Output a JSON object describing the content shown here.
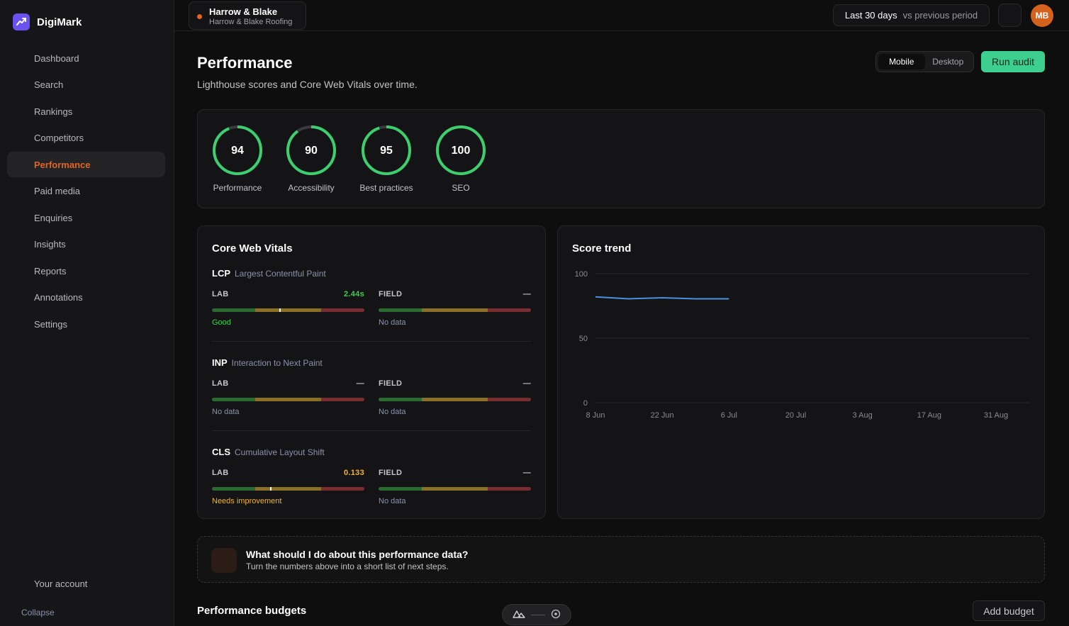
{
  "brand": {
    "name": "DigiMark",
    "logo_icon": "trend-icon"
  },
  "sidebar": {
    "items": [
      {
        "label": "Dashboard",
        "active": false
      },
      {
        "label": "Search",
        "active": false
      },
      {
        "label": "Rankings",
        "active": false
      },
      {
        "label": "Competitors",
        "active": false
      },
      {
        "label": "Performance",
        "active": true
      },
      {
        "label": "Paid media",
        "active": false
      },
      {
        "label": "Enquiries",
        "active": false
      },
      {
        "label": "Insights",
        "active": false
      },
      {
        "label": "Reports",
        "active": false
      },
      {
        "label": "Annotations",
        "active": false
      },
      {
        "label": "Settings",
        "active": false
      }
    ],
    "account_label": "Your account",
    "collapse_label": "Collapse"
  },
  "topbar": {
    "client_name": "Harrow & Blake",
    "client_sub": "Harrow & Blake Roofing",
    "range_main": "Last 30 days",
    "range_sub": "vs previous period",
    "avatar_initials": "MB"
  },
  "page": {
    "title": "Performance",
    "subtitle": "Lighthouse scores and Core Web Vitals over time.",
    "device_options": [
      "Mobile",
      "Desktop"
    ],
    "device_selected": "Mobile",
    "run_audit_label": "Run audit"
  },
  "scores": [
    {
      "value": "94",
      "label": "Performance",
      "fraction": 0.94
    },
    {
      "value": "90",
      "label": "Accessibility",
      "fraction": 0.9
    },
    {
      "value": "95",
      "label": "Best practices",
      "fraction": 0.95
    },
    {
      "value": "100",
      "label": "SEO",
      "fraction": 1.0
    }
  ],
  "cwv": {
    "title": "Core Web Vitals",
    "metrics": [
      {
        "abbr": "LCP",
        "full": "Largest Contentful Paint",
        "lab": {
          "label": "LAB",
          "value": "2.44s",
          "note": "Good",
          "status": "good",
          "marker_fraction": 0.44
        },
        "field": {
          "label": "FIELD",
          "value": "—",
          "note": "No data"
        }
      },
      {
        "abbr": "INP",
        "full": "Interaction to Next Paint",
        "lab": {
          "label": "LAB",
          "value": "—",
          "note": "No data",
          "status": "none",
          "marker_fraction": null
        },
        "field": {
          "label": "FIELD",
          "value": "—",
          "note": "No data"
        }
      },
      {
        "abbr": "CLS",
        "full": "Cumulative Layout Shift",
        "lab": {
          "label": "LAB",
          "value": "0.133",
          "note": "Needs improvement",
          "status": "warn",
          "marker_fraction": 0.38
        },
        "field": {
          "label": "FIELD",
          "value": "—",
          "note": "No data"
        }
      }
    ],
    "colors": {
      "good": "#3ccf4e",
      "warn": "#f0b429",
      "none": "#8a93ad"
    }
  },
  "chart_data": {
    "type": "line",
    "title": "Score trend",
    "x_ticks": [
      "8 Jun",
      "22 Jun",
      "6 Jul",
      "20 Jul",
      "3 Aug",
      "17 Aug",
      "31 Aug"
    ],
    "y_ticks": [
      "100",
      "50",
      "0"
    ],
    "ylim": [
      0,
      100
    ],
    "series": [
      {
        "color": "#4a8fe0",
        "points": [
          [
            0,
            82
          ],
          [
            0.25,
            80.5
          ],
          [
            0.5,
            81.3
          ],
          [
            0.75,
            80.5
          ],
          [
            1.0,
            80.5
          ]
        ]
      }
    ],
    "x_domain_ticks": 6,
    "grid": true
  },
  "advice": {
    "title": "What should I do about this performance data?",
    "subtitle": "Turn the numbers above into a short list of next steps."
  },
  "budgets": {
    "title": "Performance budgets",
    "add_label": "Add budget"
  }
}
